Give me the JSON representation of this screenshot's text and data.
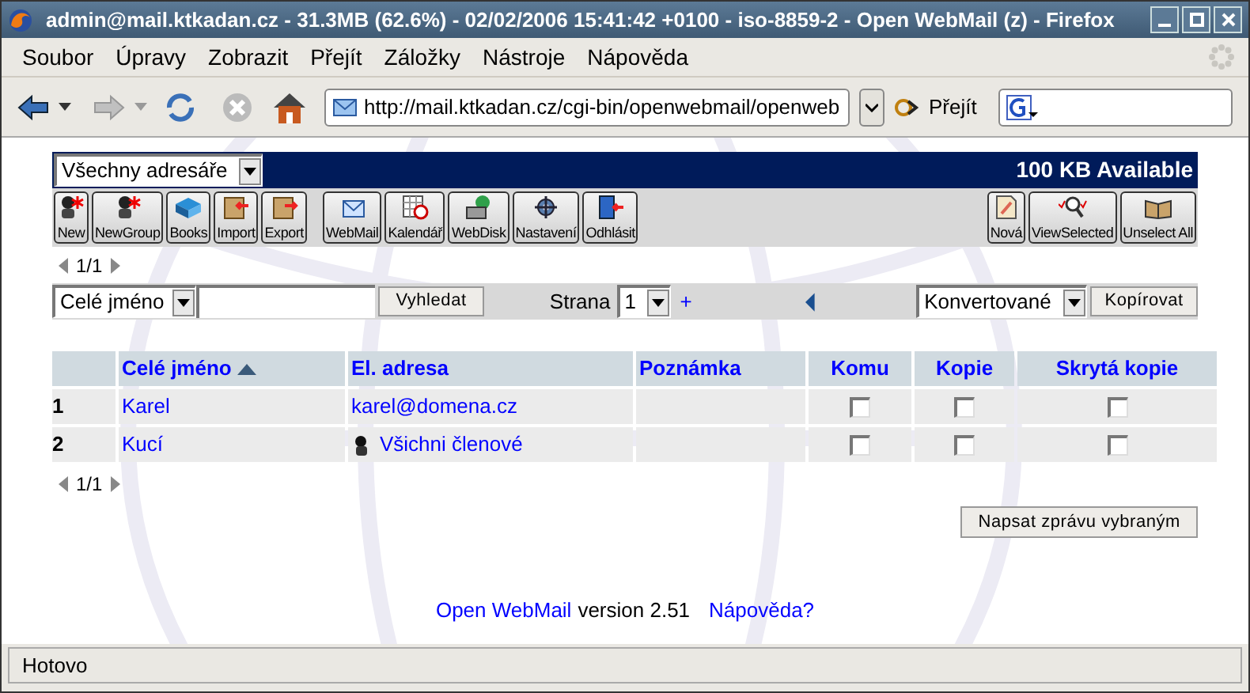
{
  "window": {
    "title": "admin@mail.ktkadan.cz - 31.3MB (62.6%) - 02/02/2006 15:41:42 +0100 - iso-8859-2 - Open WebMail (z) - Firefox"
  },
  "menu": [
    "Soubor",
    "Úpravy",
    "Zobrazit",
    "Přejít",
    "Záložky",
    "Nástroje",
    "Nápověda"
  ],
  "navbar": {
    "url": "http://mail.ktkadan.cz/cgi-bin/openwebmail/openweb",
    "go": "Přejít"
  },
  "header": {
    "addressbook": "Všechny adresáře",
    "quota": "100 KB Available"
  },
  "toolbar": {
    "left_groups": [
      [
        {
          "label": "New",
          "kind": "person"
        },
        {
          "label": "NewGroup",
          "kind": "person"
        },
        {
          "label": "Books",
          "kind": "books"
        },
        {
          "label": "Import",
          "kind": "import"
        },
        {
          "label": "Export",
          "kind": "export"
        }
      ],
      [
        {
          "label": "WebMail",
          "kind": "mail"
        },
        {
          "label": "Kalendář",
          "kind": "calendar"
        },
        {
          "label": "WebDisk",
          "kind": "disk"
        },
        {
          "label": "Nastavení",
          "kind": "settings"
        },
        {
          "label": "Odhlásit",
          "kind": "logout"
        }
      ]
    ],
    "right_group": [
      {
        "label": "Nová",
        "kind": "note"
      },
      {
        "label": "ViewSelected",
        "kind": "view"
      },
      {
        "label": "Unselect All",
        "kind": "book"
      }
    ]
  },
  "pager_top": "1/1",
  "search": {
    "field": "Celé jméno",
    "button": "Vyhledat",
    "page_label": "Strana",
    "page": "1",
    "add": "+",
    "folder": "Konvertované",
    "copy": "Kopírovat"
  },
  "table": {
    "columns": [
      {
        "label": "Celé jméno",
        "sorted": true
      },
      {
        "label": "El. adresa",
        "sorted": false
      },
      {
        "label": "Poznámka",
        "sorted": false
      },
      {
        "label": "Komu",
        "sorted": false
      },
      {
        "label": "Kopie",
        "sorted": false
      },
      {
        "label": "Skrytá kopie",
        "sorted": false
      }
    ],
    "rows": [
      {
        "index": "1",
        "name": "Karel",
        "email": "karel@domena.cz",
        "kind": "contact",
        "to": false,
        "cc": false,
        "bcc": false
      },
      {
        "index": "2",
        "name": "Kucí",
        "email": "Všichni členové",
        "kind": "group",
        "to": false,
        "cc": false,
        "bcc": false
      }
    ]
  },
  "pager_bottom": "1/1",
  "compose_button": "Napsat zprávu vybraným",
  "footer": {
    "link": "Open WebMail",
    "version": "version 2.51",
    "help": "Nápověda?"
  },
  "status_bar": "Hotovo"
}
